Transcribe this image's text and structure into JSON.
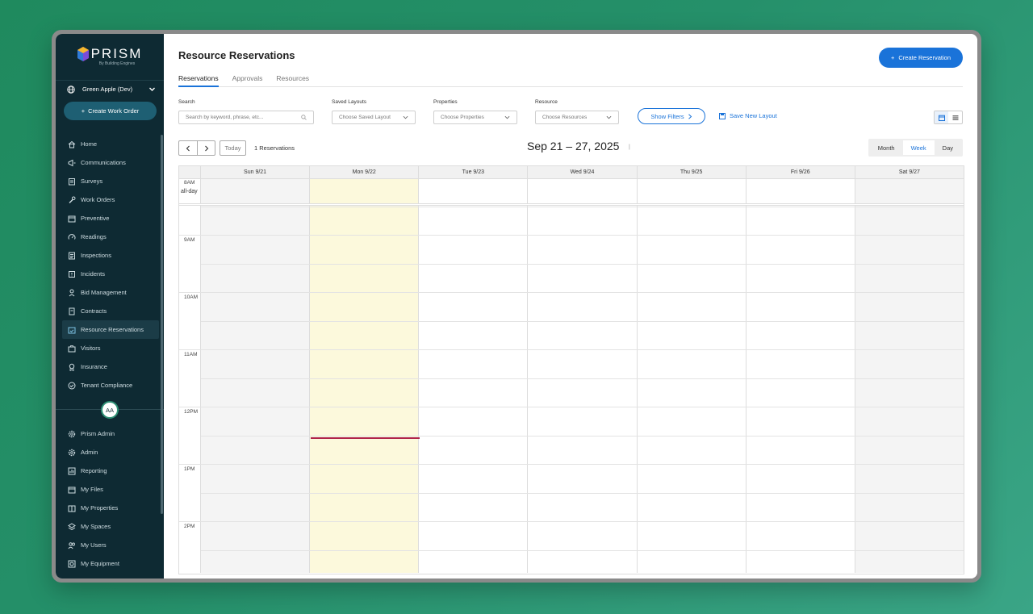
{
  "brand": {
    "name": "PRISM",
    "tagline": "By Building Engines"
  },
  "sidebar": {
    "org": "Green Apple (Dev)",
    "create_work_order": "Create Work Order",
    "items": [
      {
        "label": "Home",
        "icon": "home-icon"
      },
      {
        "label": "Communications",
        "icon": "megaphone-icon"
      },
      {
        "label": "Surveys",
        "icon": "clipboard-icon"
      },
      {
        "label": "Work Orders",
        "icon": "wrench-icon"
      },
      {
        "label": "Preventive",
        "icon": "calendar-icon"
      },
      {
        "label": "Readings",
        "icon": "gauge-icon"
      },
      {
        "label": "Inspections",
        "icon": "checklist-icon"
      },
      {
        "label": "Incidents",
        "icon": "alert-icon"
      },
      {
        "label": "Bid Management",
        "icon": "gavel-icon"
      },
      {
        "label": "Contracts",
        "icon": "document-icon"
      },
      {
        "label": "Resource Reservations",
        "icon": "calendar-check-icon"
      },
      {
        "label": "Visitors",
        "icon": "briefcase-icon"
      },
      {
        "label": "Insurance",
        "icon": "badge-icon"
      },
      {
        "label": "Tenant Compliance",
        "icon": "check-circle-icon"
      }
    ],
    "avatar_initials": "AA",
    "admin_items": [
      {
        "label": "Prism Admin",
        "icon": "gear-icon"
      },
      {
        "label": "Admin",
        "icon": "gear-icon"
      },
      {
        "label": "Reporting",
        "icon": "chart-icon"
      },
      {
        "label": "My Files",
        "icon": "file-icon"
      },
      {
        "label": "My Properties",
        "icon": "building-icon"
      },
      {
        "label": "My Spaces",
        "icon": "layers-icon"
      },
      {
        "label": "My Users",
        "icon": "users-icon"
      },
      {
        "label": "My Equipment",
        "icon": "equipment-icon"
      }
    ]
  },
  "header": {
    "title": "Resource Reservations",
    "create_button": "Create Reservation",
    "tabs": [
      "Reservations",
      "Approvals",
      "Resources"
    ]
  },
  "filters": {
    "search_label": "Search",
    "search_placeholder": "Search by keyword, phrase, etc...",
    "layouts_label": "Saved Layouts",
    "layouts_placeholder": "Choose Saved Layout",
    "properties_label": "Properties",
    "properties_placeholder": "Choose Properties",
    "resource_label": "Resource",
    "resource_placeholder": "Choose Resources",
    "show_filters": "Show Filters",
    "save_layout": "Save New Layout"
  },
  "toolbar": {
    "today": "Today",
    "count": "1 Reservations",
    "range": "Sep 21 – 27, 2025",
    "range_tick": "|",
    "modes": [
      "Month",
      "Week",
      "Day"
    ],
    "active_mode": "Week"
  },
  "calendar": {
    "days": [
      "Sun 9/21",
      "Mon 9/22",
      "Tue 9/23",
      "Wed 9/24",
      "Thu 9/25",
      "Fri 9/26",
      "Sat 9/27"
    ],
    "allday_label": "all-day",
    "hours": [
      "8AM",
      "9AM",
      "10AM",
      "11AM",
      "12PM",
      "1PM",
      "2PM"
    ]
  },
  "colors": {
    "accent": "#1a73d9",
    "sidebar_bg": "#0e2a33",
    "today_highlight": "#fcf9dc",
    "now_indicator": "#b0234a"
  }
}
